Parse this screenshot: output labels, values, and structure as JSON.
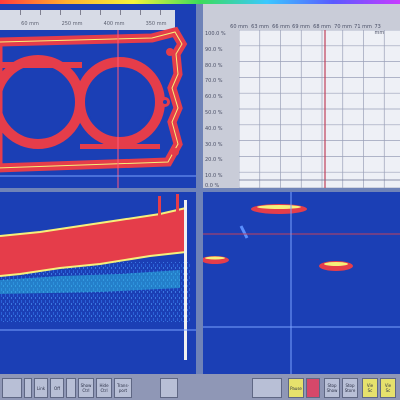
{
  "colors": {
    "background": "#1b3fb5",
    "signal": "#e53d4a",
    "echo": "#f5f07a",
    "grid": "#eef0f6"
  },
  "top_left": {
    "scale_labels": [
      "60 mm",
      "250 mm",
      "400 mm",
      "350 mm"
    ],
    "image": "cylinder-head-gasket-c-scan"
  },
  "top_right": {
    "y_labels": [
      "100.0 %",
      "90.0 %",
      "80.0 %",
      "70.0 %",
      "60.0 %",
      "50.0 %",
      "40.0 %",
      "30.0 %",
      "20.0 %",
      "10.0 %",
      "0.0 %"
    ],
    "x_labels": [
      "60 mm",
      "63 mm",
      "66 mm",
      "69 mm",
      "68 mm",
      "70 mm",
      "71 mm",
      "73 mm",
      "75 mm"
    ]
  },
  "bottom_left": {
    "image": "b-scan-cross-section"
  },
  "bottom_right": {
    "image": "d-scan-spot-view"
  },
  "toolbar": {
    "buttons": [
      {
        "label": "",
        "style": "plain"
      },
      {
        "label": "",
        "style": "plain"
      },
      {
        "label": "Link",
        "style": "plain"
      },
      {
        "label": "Off",
        "style": "plain"
      },
      {
        "label": "",
        "style": "plain"
      },
      {
        "label": "Show\nCtrl",
        "style": "plain"
      },
      {
        "label": "Hide\nCtrl",
        "style": "plain"
      },
      {
        "label": "Trans-\nport",
        "style": "plain"
      },
      {
        "label": "",
        "style": "plain"
      },
      {
        "label": "",
        "style": "plain"
      },
      {
        "label": "Pause",
        "style": "yellow"
      },
      {
        "label": "",
        "style": "red"
      },
      {
        "label": "Stop\nShow",
        "style": "plain"
      },
      {
        "label": "Stop\nStore",
        "style": "plain"
      },
      {
        "label": "Vie\nSc",
        "style": "yellow"
      },
      {
        "label": "Vie\nSc",
        "style": "yellow"
      }
    ]
  }
}
